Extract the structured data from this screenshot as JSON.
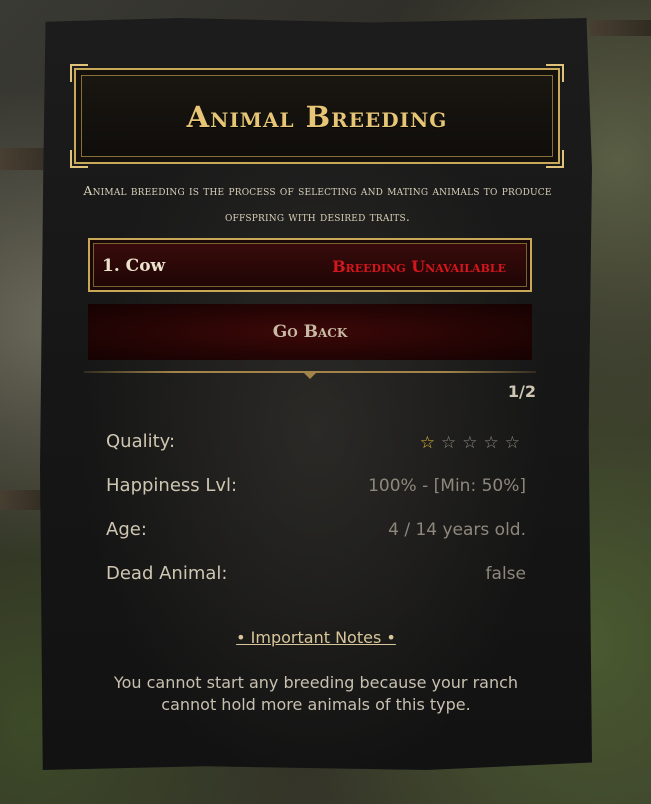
{
  "title": "Animal Breeding",
  "subtitle": "Animal breeding is the process of selecting and mating animals to produce offspring with desired traits.",
  "selected_item": {
    "name": "1. Cow",
    "status": "Breeding Unavailable"
  },
  "back_button": {
    "label": "Go Back"
  },
  "pager": "1/2",
  "stats": {
    "quality_label": "Quality:",
    "quality_rating": 1,
    "quality_max": 5,
    "happiness_label": "Happiness Lvl:",
    "happiness_value": "100% - [Min: 50%]",
    "age_label": "Age:",
    "age_value": "4 / 14 years old.",
    "dead_label": "Dead Animal:",
    "dead_value": "false"
  },
  "notes": {
    "title": "• Important Notes •",
    "text": "You cannot start any breeding because your ranch cannot hold more animals of this type."
  },
  "colors": {
    "gold": "#c9a85a",
    "status_red": "#d4171c"
  }
}
